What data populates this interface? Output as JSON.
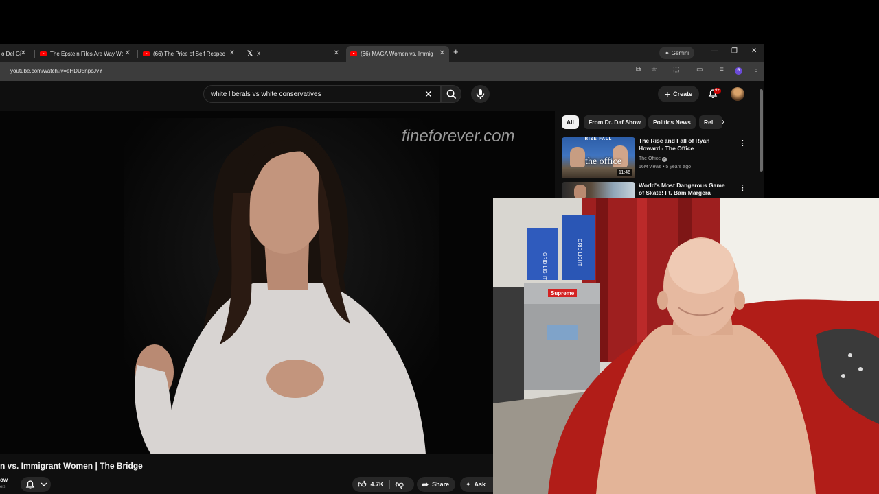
{
  "browser": {
    "tabs": [
      {
        "title": "o Del Gi",
        "icon": "generic"
      },
      {
        "title": "The Epstein Files Are Way Wors",
        "icon": "youtube-icon"
      },
      {
        "title": "(66) The Price of Self Respect -",
        "icon": "youtube-icon"
      },
      {
        "title": "X",
        "icon": "x-icon"
      },
      {
        "title": "(66) MAGA Women vs. Immigra",
        "icon": "youtube-icon",
        "active": true
      }
    ],
    "gemini_label": "Gemini",
    "url": "youtube.com/watch?v=eHDU5npcJvY"
  },
  "youtube": {
    "search_query": "white liberals vs white conservatives",
    "create_label": "Create",
    "notification_badge": "9+",
    "video": {
      "watermark": "fineforever.com",
      "title": "n vs. Immigrant Women | The Bridge",
      "channel_fragment": "ow",
      "subscribers_fragment": "ers",
      "like_count": "4.7K",
      "share_label": "Share",
      "ask_label": "Ask"
    },
    "chips": [
      {
        "label": "All",
        "selected": true
      },
      {
        "label": "From Dr. Daf Show"
      },
      {
        "label": "Politics News"
      },
      {
        "label": "Rel"
      }
    ],
    "recommendations": [
      {
        "title": "The Rise and Fall of Ryan Howard - The Office",
        "channel": "The Office",
        "meta": "16M views • 5 years ago",
        "duration": "11:46",
        "thumb_text_top": "RISE      FALL",
        "thumb_text": "the office"
      },
      {
        "title": "World's Most Dangerous Game of Skate! Ft. Bam Margera",
        "channel": "",
        "meta": "",
        "duration": ""
      }
    ]
  },
  "webcam": {
    "box_label_1": "GRID LIGHT",
    "box_label_2": "GRID LIGHT",
    "sticker_label": "Supreme"
  }
}
